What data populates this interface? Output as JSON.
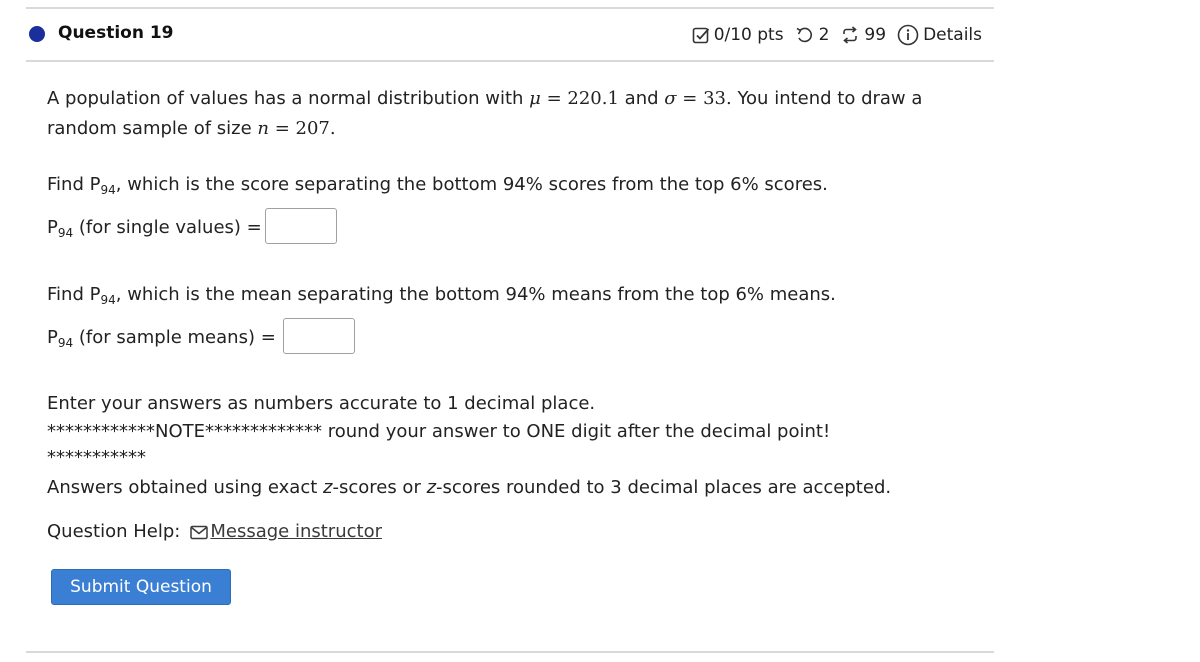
{
  "header": {
    "question_title": "Question 19",
    "points": "0/10 pts",
    "retries": "2",
    "attempts": "99",
    "details_label": "Details",
    "dot_color": "#1b2f9c"
  },
  "problem": {
    "intro_1": "A population of values has a normal distribution with ",
    "mu_sym": "μ",
    "eq": " = ",
    "mu_val": "220.1",
    "and": " and ",
    "sigma_sym": "σ",
    "sigma_val": "33.",
    "intro_2": " You intend to draw a",
    "intro_3": "random sample of size ",
    "n_sym": "n",
    "n_val": "207."
  },
  "part1": {
    "find_pre": "Find P",
    "sub": "94",
    "find_post": ", which is the score separating the bottom 94% scores from the top 6% scores.",
    "label_p": "P",
    "label_sub": "94",
    "label_text": " (for single values) =",
    "answer_value": ""
  },
  "part2": {
    "find_pre": "Find P",
    "sub": "94",
    "find_post": ", which is the mean separating the bottom 94% means from the top 6% means.",
    "label_p": "P",
    "label_sub": "94",
    "label_text": " (for sample means) =",
    "answer_value": ""
  },
  "instructions": {
    "line1": "Enter your answers as numbers accurate to 1 decimal place.",
    "line2": "************NOTE************* round your answer to ONE digit after the decimal point!",
    "line3": "***********",
    "line4_pre": "Answers obtained using exact ",
    "z1": "z",
    "line4_mid": "-scores or ",
    "z2": "z",
    "line4_post": "-scores rounded to 3 decimal places are accepted."
  },
  "help": {
    "label": "Question Help:",
    "link_text": "Message instructor"
  },
  "submit_label": "Submit Question",
  "colors": {
    "accent": "#3a7fd4",
    "rule": "#d9d9d9"
  }
}
